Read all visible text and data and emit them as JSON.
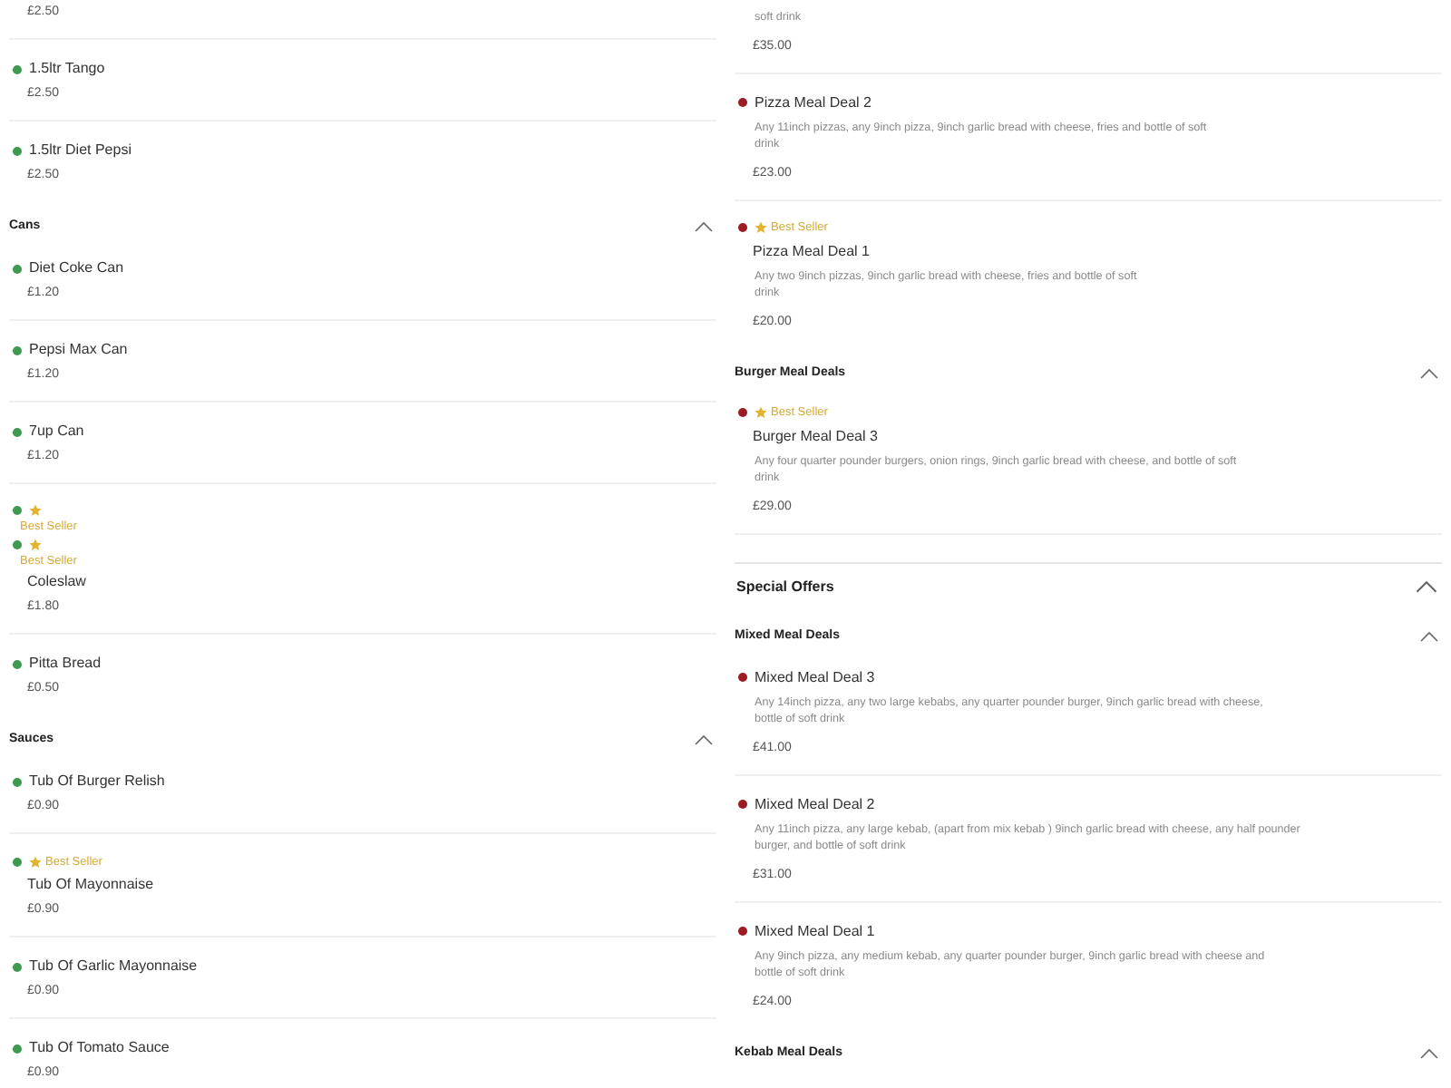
{
  "columns": [
    {
      "categories": [
        {
          "groups": [
            {
              "items": [
                {
                  "kind": "plain",
                  "price": "£2.50"
                },
                {
                  "kind": "plain",
                  "name": "1.5ltr Tango",
                  "price": "£2.50",
                  "color": "#3f9a4f"
                },
                {
                  "kind": "plain",
                  "name": "1.5ltr Diet Pepsi",
                  "price": "£2.50",
                  "color": "#3f9a4f"
                }
              ]
            },
            {
              "title": "Cans",
              "items": [
                {
                  "kind": "plain",
                  "name": "Diet Coke Can",
                  "price": "£1.20",
                  "color": "#3f9a4f"
                },
                {
                  "kind": "plain",
                  "name": "Pepsi Max Can",
                  "price": "£1.20",
                  "color": "#3f9a4f"
                },
                {
                  "kind": "plain",
                  "name": "7up Can",
                  "price": "£1.20",
                  "color": "#3f9a4f"
                },
                {
                  "kind": "badge-stacked",
                  "badge": "Best Seller",
                  "color": "#3f9a4f"
                },
                {
                  "kind": "badge-stacked",
                  "badge": "Best Seller",
                  "name": "Coleslaw",
                  "price": "£1.80",
                  "color": "#3f9a4f"
                },
                {
                  "kind": "plain",
                  "name": "Pitta Bread",
                  "price": "£0.50",
                  "color": "#3f9a4f"
                }
              ]
            },
            {
              "title": "Sauces",
              "items": [
                {
                  "kind": "plain",
                  "name": "Tub Of Burger Relish",
                  "price": "£0.90",
                  "color": "#3f9a4f"
                },
                {
                  "kind": "badge-inline",
                  "badge": "Best Seller",
                  "name": "Tub Of Mayonnaise",
                  "price": "£0.90",
                  "color": "#3f9a4f"
                },
                {
                  "kind": "plain",
                  "name": "Tub Of Garlic Mayonnaise",
                  "price": "£0.90",
                  "color": "#3f9a4f"
                },
                {
                  "kind": "plain",
                  "name": "Tub Of Tomato Sauce",
                  "price": "£0.90",
                  "color": "#3f9a4f"
                }
              ]
            }
          ]
        }
      ]
    },
    {
      "categories": [
        {
          "groups": [
            {
              "items": [
                {
                  "kind": "plain",
                  "description": [
                    "soft drink"
                  ],
                  "price": "£35.00"
                },
                {
                  "kind": "plain",
                  "name": "Pizza Meal Deal 2",
                  "description": [
                    "Any 11inch pizzas, any 9inch pizza, 9inch garlic bread with cheese, fries and bottle of soft",
                    "drink"
                  ],
                  "price": "£23.00",
                  "color": "#9b1c22"
                },
                {
                  "kind": "badge-inline",
                  "badge": "Best Seller",
                  "name": "Pizza Meal Deal 1",
                  "description": [
                    "Any two 9inch pizzas, 9inch garlic bread with cheese, fries and bottle of soft",
                    "drink"
                  ],
                  "price": "£20.00",
                  "color": "#9b1c22"
                }
              ]
            },
            {
              "title": "Burger Meal Deals",
              "items": [
                {
                  "kind": "badge-inline",
                  "badge": "Best Seller",
                  "name": "Burger Meal Deal 3",
                  "description": [
                    "Any four quarter pounder burgers, onion rings, 9inch garlic bread with cheese, and bottle of soft",
                    "drink"
                  ],
                  "price": "£29.00",
                  "color": "#9b1c22"
                }
              ]
            }
          ]
        },
        {
          "title": "Special Offers",
          "groups": [
            {
              "title": "Mixed Meal Deals",
              "items": [
                {
                  "kind": "plain",
                  "name": "Mixed Meal Deal 3",
                  "description": [
                    "Any 14inch pizza, any two large kebabs, any quarter pounder burger, 9inch garlic bread with cheese,",
                    "bottle of soft drink"
                  ],
                  "price": "£41.00",
                  "color": "#9b1c22"
                },
                {
                  "kind": "plain",
                  "name": "Mixed Meal Deal 2",
                  "description": [
                    "Any 11inch pizza, any large kebab, (apart from mix kebab ) 9inch garlic bread with cheese, any half pounder",
                    "burger, and bottle of soft drink"
                  ],
                  "price": "£31.00",
                  "color": "#9b1c22"
                },
                {
                  "kind": "plain",
                  "name": "Mixed Meal Deal 1",
                  "description": [
                    "Any 9inch pizza, any medium kebab, any quarter pounder burger, 9inch garlic bread with cheese and",
                    "bottle of soft drink"
                  ],
                  "price": "£24.00",
                  "color": "#9b1c22"
                }
              ]
            },
            {
              "title": "Kebab Meal Deals"
            }
          ]
        }
      ]
    }
  ]
}
